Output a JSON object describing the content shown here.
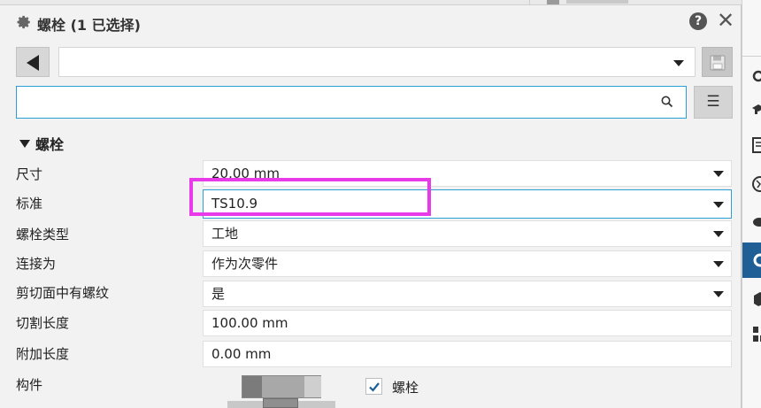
{
  "panel": {
    "title": "螺栓 (1 已选择)",
    "help_label": "?",
    "close_label": "✕"
  },
  "preset": {
    "value": ""
  },
  "search": {
    "value": "",
    "placeholder": ""
  },
  "section": {
    "title": "螺栓"
  },
  "properties": [
    {
      "label": "尺寸",
      "value": "20.00 mm",
      "type": "select"
    },
    {
      "label": "标准",
      "value": "TS10.9",
      "type": "select",
      "active": true
    },
    {
      "label": "螺栓类型",
      "value": "工地",
      "type": "select"
    },
    {
      "label": "连接为",
      "value": "作为次零件",
      "type": "select"
    },
    {
      "label": "剪切面中有螺纹",
      "value": "是",
      "type": "select"
    },
    {
      "label": "切割长度",
      "value": "100.00 mm",
      "type": "text"
    },
    {
      "label": "附加长度",
      "value": "0.00 mm",
      "type": "text"
    }
  ],
  "component": {
    "label": "构件",
    "check_label": "螺栓",
    "checked": true
  },
  "icons": {
    "title": "gear-icon",
    "back": "triangle-left-icon",
    "save": "save-icon",
    "search": "magnifier-icon",
    "menu": "menu-icon",
    "dropdown": "chevron-down-icon"
  },
  "colors": {
    "accent": "#2a9fd6",
    "highlight": "#e83ae8",
    "side_active": "#1f5f96"
  }
}
